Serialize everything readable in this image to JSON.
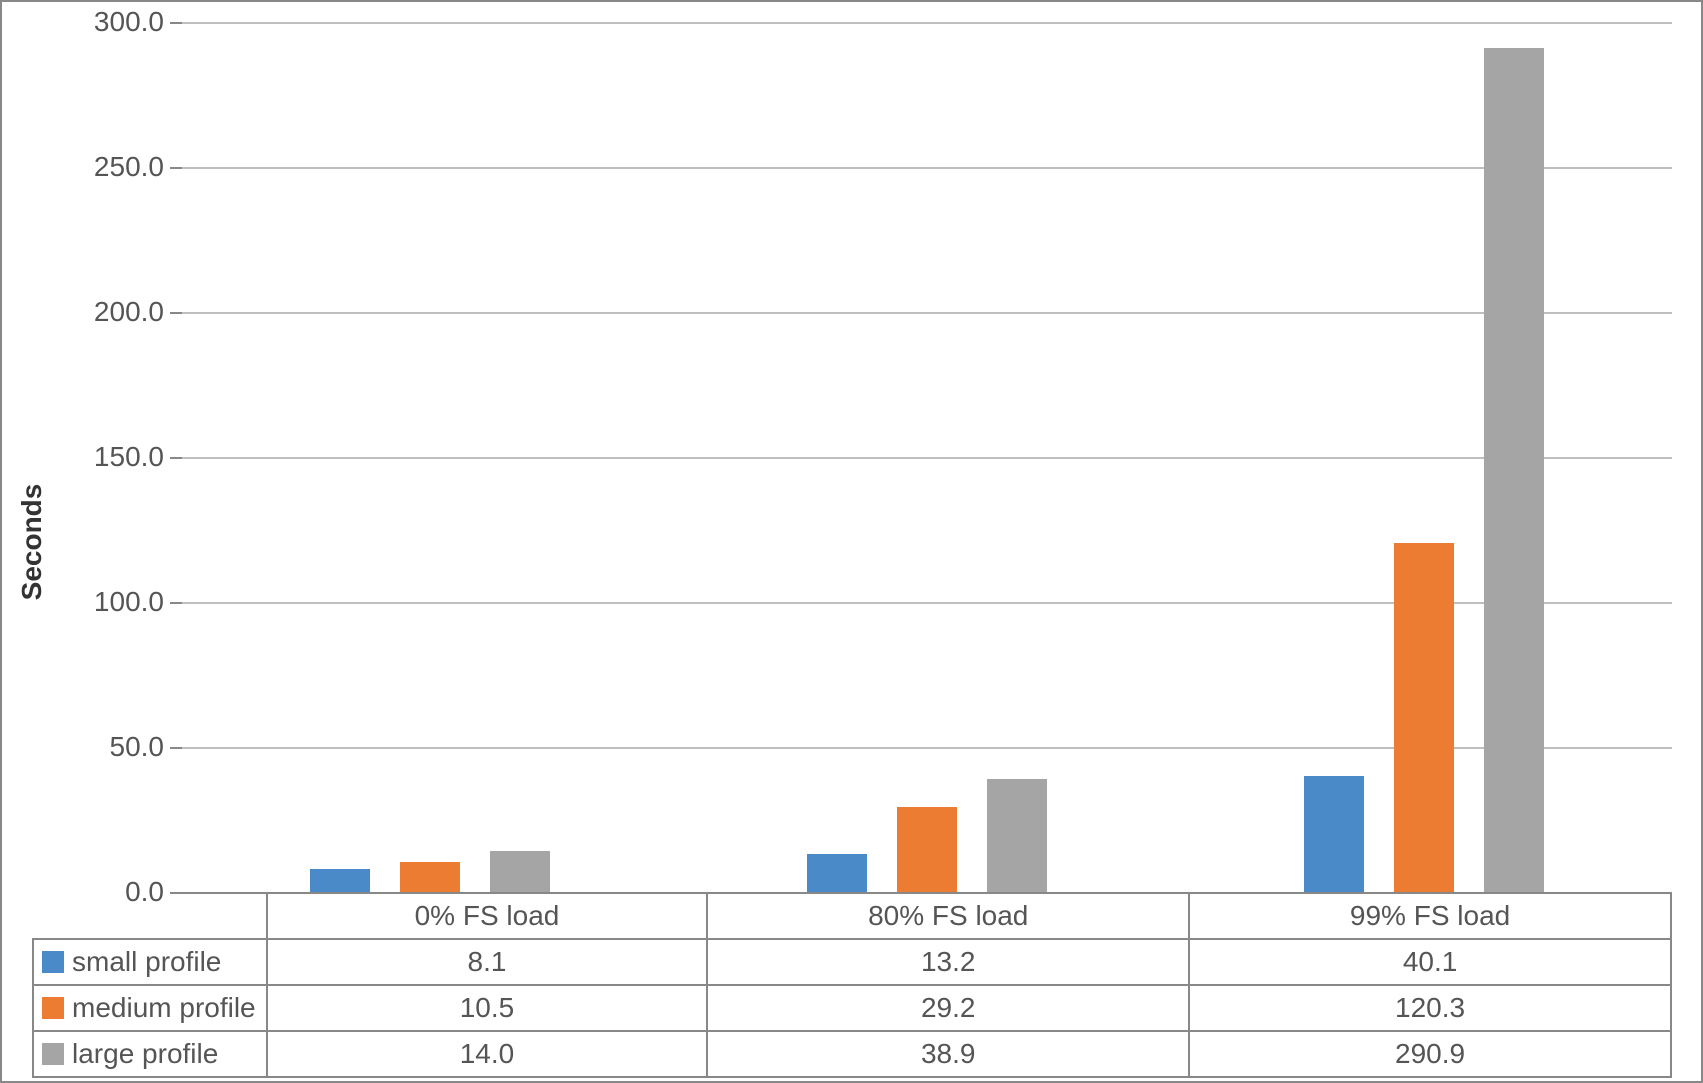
{
  "chart_data": {
    "type": "bar",
    "categories": [
      "0% FS load",
      "80% FS load",
      "99% FS load"
    ],
    "series": [
      {
        "name": "small profile",
        "values": [
          8.1,
          13.2,
          40.1
        ]
      },
      {
        "name": "medium profile",
        "values": [
          10.5,
          29.2,
          120.3
        ]
      },
      {
        "name": "large profile",
        "values": [
          14.0,
          38.9,
          290.9
        ]
      }
    ],
    "title": "",
    "xlabel": "",
    "ylabel": "Seconds",
    "ylim": [
      0,
      300
    ],
    "ytick_step": 50,
    "yticks": [
      "0.0",
      "50.0",
      "100.0",
      "150.0",
      "200.0",
      "250.0",
      "300.0"
    ],
    "colors": {
      "small": "#4a8ac9",
      "medium": "#ec7c31",
      "large": "#a5a5a5"
    }
  },
  "table": {
    "headers": [
      "0% FS load",
      "80% FS load",
      "99% FS load"
    ],
    "rows": [
      {
        "label": "small profile",
        "cells": [
          "8.1",
          "13.2",
          "40.1"
        ]
      },
      {
        "label": "medium profile",
        "cells": [
          "10.5",
          "29.2",
          "120.3"
        ]
      },
      {
        "label": "large profile",
        "cells": [
          "14.0",
          "38.9",
          "290.9"
        ]
      }
    ]
  }
}
